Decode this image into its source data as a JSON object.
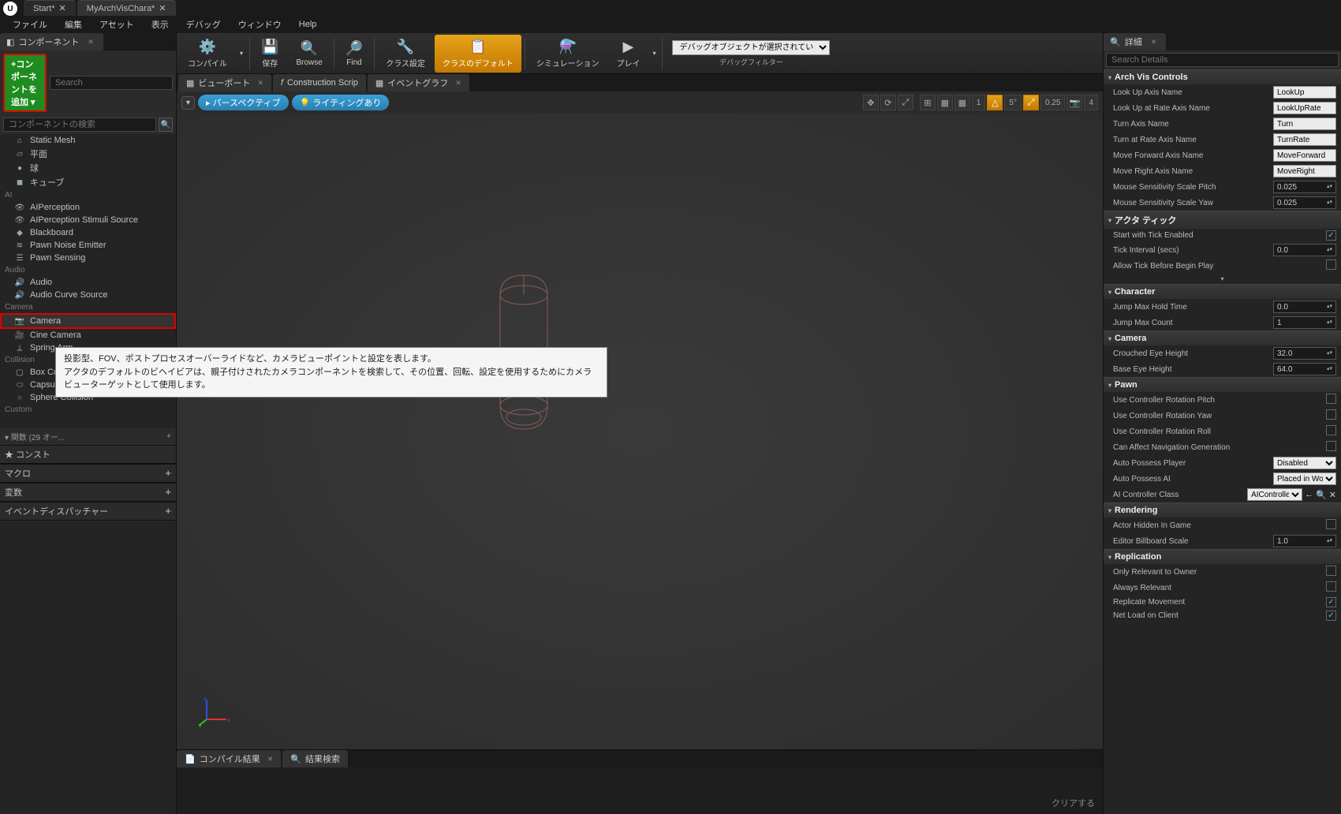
{
  "title_tabs": {
    "t0": "Start*",
    "t1": "MyArchVisChara*"
  },
  "menu": {
    "file": "ファイル",
    "edit": "編集",
    "asset": "アセット",
    "view": "表示",
    "debug": "デバッグ",
    "window": "ウィンドウ",
    "help": "Help"
  },
  "comp_panel": {
    "tab": "コンポーネント",
    "add_label": "+コンポーネントを追加 ▾",
    "search_placeholder": "Search",
    "search2_placeholder": "コンポーネントの検索",
    "cats": {
      "common": "",
      "ai": "AI",
      "audio": "Audio",
      "camera": "Camera",
      "collision": "Collision",
      "custom": "Custom"
    },
    "items": {
      "static_mesh": "Static Mesh",
      "plane": "平面",
      "sphere": "球",
      "cube": "キューブ",
      "aiperception": "AIPerception",
      "aiss": "AIPerception Stimuli Source",
      "blackboard": "Blackboard",
      "pne": "Pawn Noise Emitter",
      "psense": "Pawn Sensing",
      "audio_c": "Audio",
      "acs": "Audio Curve Source",
      "camera": "Camera",
      "cine": "Cine Camera",
      "spring": "Spring Arm",
      "box": "Box Collision",
      "capsule": "Capsule Collision",
      "sphere_c": "Sphere Collision"
    },
    "func_row": "関数 (29 オー...",
    "constr": "コンスト",
    "macro": "マクロ",
    "vars": "変数",
    "event_disp": "イベントディスパッチャー"
  },
  "toolbar": {
    "compile": "コンパイル",
    "save": "保存",
    "browse": "Browse",
    "find": "Find",
    "class_set": "クラス設定",
    "class_def": "クラスのデフォルト",
    "sim": "シミュレーション",
    "play": "プレイ",
    "debug_none": "デバッグオブジェクトが選択されていません▾",
    "debug_filter": "デバッグフィルター"
  },
  "center_tabs": {
    "viewport": "ビューポート",
    "cons": "Construction Scrip",
    "evtgraph": "イベントグラフ"
  },
  "vp_bar": {
    "dd": "▾",
    "persp": "パースペクティブ",
    "lit": "ライティングあり",
    "speed": "0.25",
    "snap": "4",
    "angle": "5°",
    "grid": "1"
  },
  "tooltip": {
    "l1": "投影型、FOV、ポストプロセスオーバーライドなど、カメラビューポイントと設定を表します。",
    "l2": "アクタのデフォルトのビヘイビアは、親子付けされたカメラコンポーネントを検索して、その位置、回転、設定を使用するためにカメラビューターゲットとして使用します。"
  },
  "log_tabs": {
    "compile": "コンパイル結果",
    "search": "結果検索"
  },
  "clear": "クリアする",
  "details": {
    "tab": "詳細",
    "search_ph": "Search Details",
    "cat_arch": "Arch Vis Controls",
    "lookup_name": "Look Up Axis Name",
    "lookup_val": "LookUp",
    "lookuprate_name": "Look Up at Rate Axis Name",
    "lookuprate_val": "LookUpRate",
    "turn_name": "Turn Axis Name",
    "turn_val": "Turn",
    "turnrate_name": "Turn at Rate Axis Name",
    "turnrate_val": "TurnRate",
    "movefw_name": "Move Forward Axis Name",
    "movefw_val": "MoveForward",
    "mover_name": "Move Right Axis Name",
    "mover_val": "MoveRight",
    "mssp_name": "Mouse Sensitivity Scale Pitch",
    "mssp_val": "0.025",
    "mssy_name": "Mouse Sensitivity Scale Yaw",
    "mssy_val": "0.025",
    "cat_actor": "アクタ ティック",
    "swt_name": "Start with Tick Enabled",
    "tint_name": "Tick Interval (secs)",
    "tint_val": "0.0",
    "atbbp_name": "Allow Tick Before Begin Play",
    "cat_char": "Character",
    "jmht_name": "Jump Max Hold Time",
    "jmht_val": "0.0",
    "jmc_name": "Jump Max Count",
    "jmc_val": "1",
    "cat_cam": "Camera",
    "ceh_name": "Crouched Eye Height",
    "ceh_val": "32.0",
    "beh_name": "Base Eye Height",
    "beh_val": "64.0",
    "cat_pawn": "Pawn",
    "ucrp": "Use Controller Rotation Pitch",
    "ucry": "Use Controller Rotation Yaw",
    "ucrr": "Use Controller Rotation Roll",
    "cang": "Can Affect Navigation Generation",
    "app_name": "Auto Possess Player",
    "app_val": "Disabled",
    "apa_name": "Auto Possess AI",
    "apa_val": "Placed in World",
    "aic_name": "AI Controller Class",
    "aic_val": "AIController",
    "cat_rend": "Rendering",
    "ahig": "Actor Hidden In Game",
    "ebs_name": "Editor Billboard Scale",
    "ebs_val": "1.0",
    "cat_rep": "Replication",
    "oro": "Only Relevant to Owner",
    "ar": "Always Relevant",
    "rm": "Replicate Movement",
    "nloc": "Net Load on Client"
  }
}
